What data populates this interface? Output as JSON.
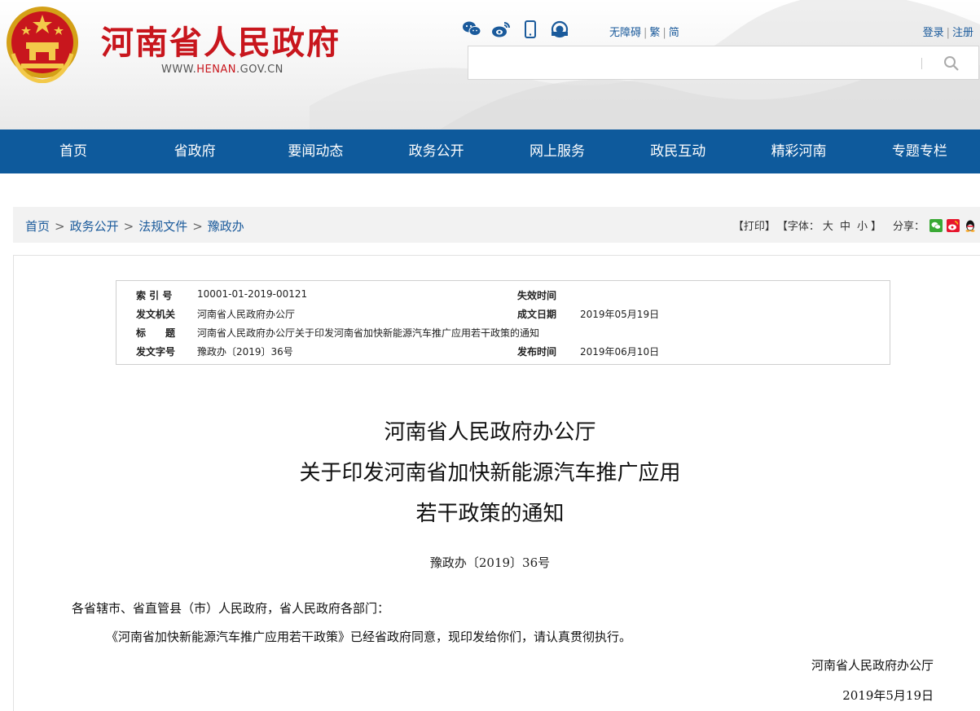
{
  "site": {
    "title": "河南省人民政府",
    "url_prefix": "WWW.",
    "url_brand": "HENAN",
    "url_suffix": ".GOV.CN"
  },
  "top_icons": [
    "wechat-icon",
    "weibo-icon",
    "mobile-icon",
    "client-icon"
  ],
  "accessibility": {
    "barrier_free": "无障碍",
    "traditional": "繁",
    "simplified": "简"
  },
  "auth": {
    "login": "登录",
    "register": "注册"
  },
  "search": {
    "placeholder": ""
  },
  "nav": [
    "首页",
    "省政府",
    "要闻动态",
    "政务公开",
    "网上服务",
    "政民互动",
    "精彩河南",
    "专题专栏"
  ],
  "breadcrumb": [
    "首页",
    "政务公开",
    "法规文件",
    "豫政办"
  ],
  "tools": {
    "print": "【打印】",
    "font_prefix": "【字体：",
    "font_large": "大",
    "font_medium": "中",
    "font_small": "小",
    "font_suffix": "】",
    "share_label": "分享："
  },
  "meta": {
    "index_label": "索 引 号",
    "index_value": "10001-01-2019-00121",
    "expire_label": "失效时间",
    "expire_value": "",
    "issuer_label": "发文机关",
    "issuer_value": "河南省人民政府办公厅",
    "date_label": "成文日期",
    "date_value": "2019年05月19日",
    "subject_label": "标　　题",
    "subject_value": "河南省人民政府办公厅关于印发河南省加快新能源汽车推广应用若干政策的通知",
    "docno_label": "发文字号",
    "docno_value": "豫政办〔2019〕36号",
    "publish_label": "发布时间",
    "publish_value": "2019年06月10日"
  },
  "document": {
    "title_line1": "河南省人民政府办公厅",
    "title_line2": "关于印发河南省加快新能源汽车推广应用",
    "title_line3": "若干政策的通知",
    "doc_number": "豫政办〔2019〕36号",
    "salutation": "各省辖市、省直管县（市）人民政府，省人民政府各部门：",
    "body": "《河南省加快新能源汽车推广应用若干政策》已经省政府同意，现印发给你们，请认真贯彻执行。",
    "signature": "河南省人民政府办公厅",
    "sign_date": "2019年5月19日"
  },
  "colors": {
    "brand_red": "#c8161d",
    "nav_blue": "#0e5a9c",
    "link_blue": "#1a5a9b"
  }
}
